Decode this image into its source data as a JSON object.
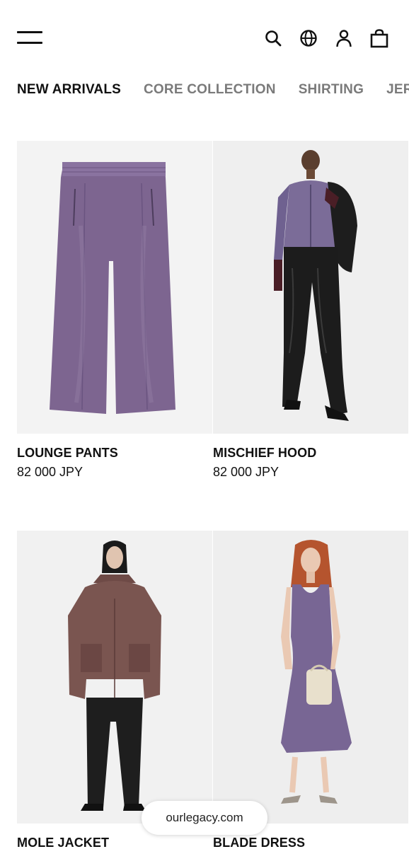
{
  "header": {
    "menu_icon": "hamburger-menu-icon",
    "icons": [
      "search-icon",
      "globe-icon",
      "account-icon",
      "shopping-bag-icon"
    ]
  },
  "categories": [
    {
      "label": "NEW ARRIVALS",
      "active": true
    },
    {
      "label": "CORE COLLECTION",
      "active": false
    },
    {
      "label": "SHIRTING",
      "active": false
    },
    {
      "label": "JERSEY",
      "active": false
    }
  ],
  "products": [
    {
      "name": "LOUNGE PANTS",
      "price": "82 000 JPY"
    },
    {
      "name": "MISCHIEF HOOD",
      "price": "82 000 JPY"
    },
    {
      "name": "MOLE JACKET",
      "price": ""
    },
    {
      "name": "BLADE DRESS",
      "price": ""
    }
  ],
  "url_bar": {
    "domain": "ourlegacy.com"
  },
  "colors": {
    "text": "#111111",
    "inactive_tab": "#7a7a7a",
    "image_bg": "#f2f2f2",
    "purple_garment": "#7d6590",
    "brown_jacket": "#7a5550",
    "leather_black": "#1c1c1c"
  }
}
